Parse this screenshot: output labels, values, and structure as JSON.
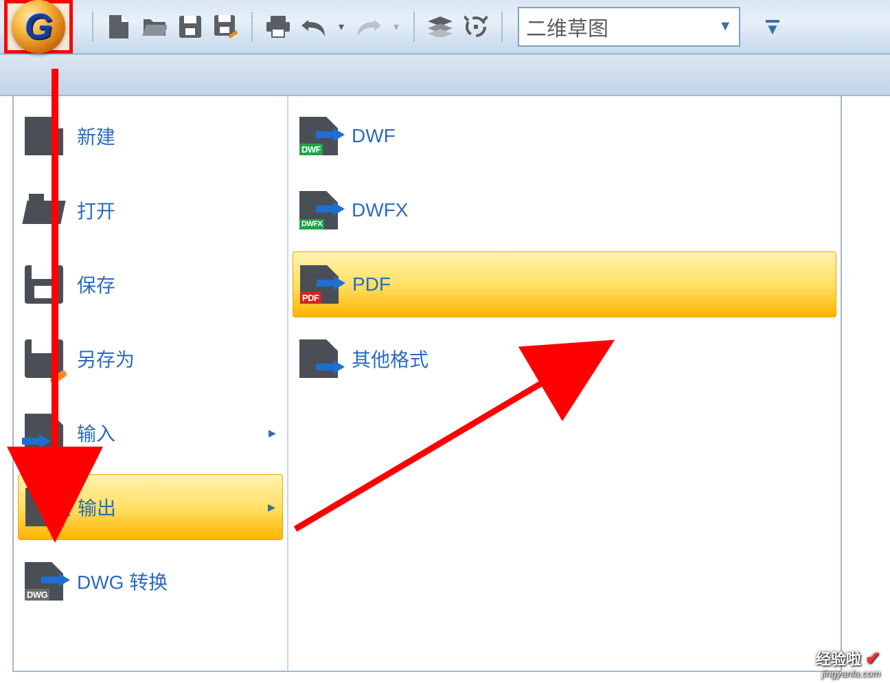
{
  "colors": {
    "accent_blue": "#1f6fd0",
    "highlight_red": "#ff0000",
    "menu_highlight": "#ffe066"
  },
  "toolbar": {
    "app_button_glyph": "G",
    "workspace_label": "二维草图",
    "icons": {
      "new": "new-file",
      "open": "open-file",
      "save": "save",
      "saveas": "save-as",
      "print": "print",
      "undo": "undo",
      "redo": "redo",
      "layers": "layers",
      "help": "help"
    }
  },
  "left_menu": [
    {
      "id": "new",
      "label": "新建"
    },
    {
      "id": "open",
      "label": "打开"
    },
    {
      "id": "save",
      "label": "保存"
    },
    {
      "id": "saveas",
      "label": "另存为"
    },
    {
      "id": "import",
      "label": "输入",
      "has_submenu": true
    },
    {
      "id": "export",
      "label": "输出",
      "has_submenu": true,
      "highlighted": true,
      "redbox": true
    },
    {
      "id": "dwgconv",
      "label": "DWG 转换",
      "tag": "DWG"
    }
  ],
  "right_menu": [
    {
      "id": "dwf",
      "label": "DWF",
      "tag": "DWF",
      "tag_color": "green"
    },
    {
      "id": "dwfx",
      "label": "DWFX",
      "tag": "DWFX",
      "tag_color": "green"
    },
    {
      "id": "pdf",
      "label": "PDF",
      "tag": "PDF",
      "tag_color": "red",
      "highlighted": true,
      "redbox": true
    },
    {
      "id": "other",
      "label": "其他格式"
    }
  ],
  "watermark": {
    "line1": "经验啦",
    "check": "✔",
    "line2": "jingyanla.com"
  }
}
